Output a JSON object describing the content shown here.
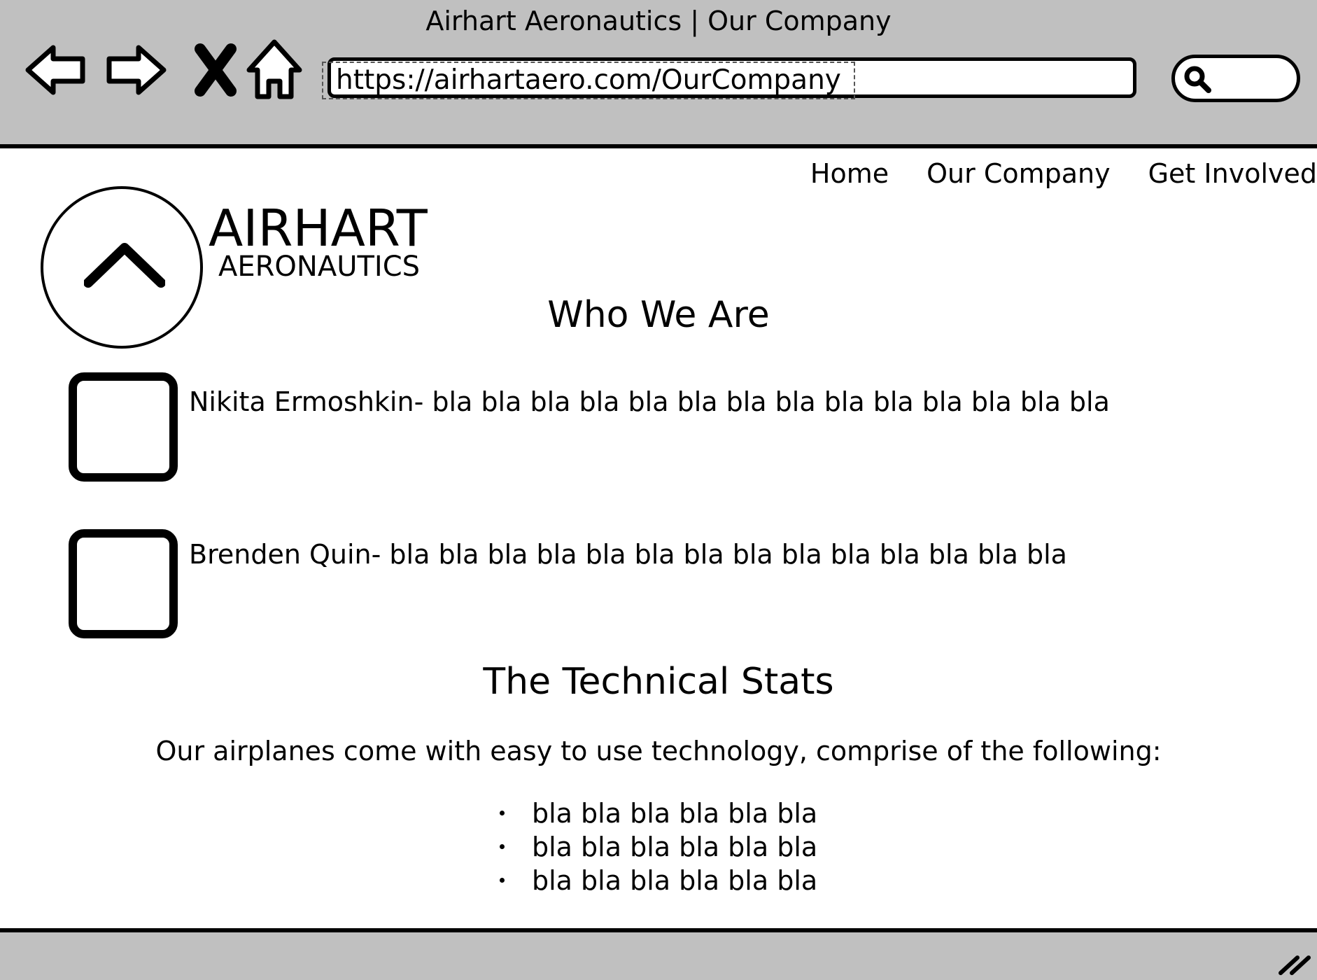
{
  "window": {
    "title": "Airhart Aeronautics | Our Company"
  },
  "toolbar": {
    "back_icon": "back-arrow-icon",
    "forward_icon": "forward-arrow-icon",
    "stop_icon": "stop-x-icon",
    "home_icon": "home-icon",
    "url": "https://airhartaero.com/OurCompany",
    "search_icon": "search-icon"
  },
  "nav": {
    "items": [
      {
        "label": "Home"
      },
      {
        "label": "Our Company"
      },
      {
        "label": "Get Involved"
      }
    ]
  },
  "brand": {
    "name": "AIRHART",
    "sub": "AERONAUTICS",
    "logo_icon": "chevron-up-icon"
  },
  "who": {
    "heading": "Who We Are",
    "members": [
      {
        "text": "Nikita Ermoshkin- bla bla bla bla bla bla bla bla bla bla bla bla bla bla"
      },
      {
        "text": "Brenden Quin- bla bla bla bla bla bla bla bla bla bla bla bla bla bla"
      }
    ]
  },
  "tech": {
    "heading": "The Technical Stats",
    "intro": "Our airplanes come with easy to use technology, comprise of the following:",
    "items": [
      "bla bla bla bla bla bla",
      "bla bla bla bla bla bla",
      "bla bla bla bla bla bla"
    ]
  },
  "colors": {
    "chrome": "#c0c0c0",
    "ink": "#000000",
    "page": "#ffffff"
  }
}
